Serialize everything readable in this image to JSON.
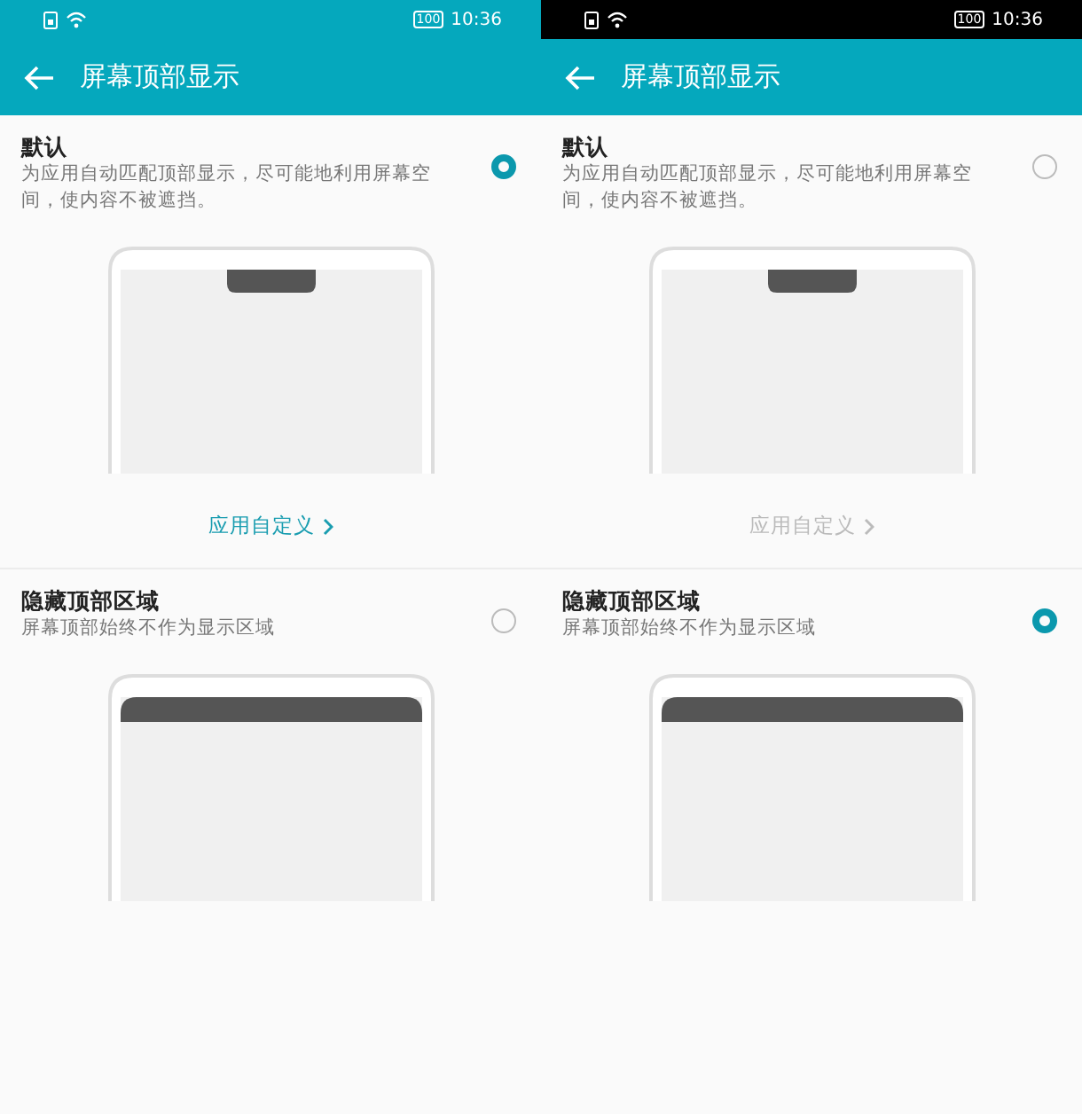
{
  "screens": [
    {
      "status_bar": {
        "kind": "teal",
        "battery": "100",
        "time": "10:36"
      },
      "title": "屏幕顶部显示",
      "options": [
        {
          "kind": "notch",
          "title": "默认",
          "description": "为应用自动匹配顶部显示，尽可能地利用屏幕空间，使内容不被遮挡。",
          "selected": true,
          "link": {
            "label": "应用自定义",
            "disabled": false
          }
        },
        {
          "kind": "hidden",
          "title": "隐藏顶部区域",
          "description": "屏幕顶部始终不作为显示区域",
          "selected": false
        }
      ]
    },
    {
      "status_bar": {
        "kind": "dark",
        "battery": "100",
        "time": "10:36"
      },
      "title": "屏幕顶部显示",
      "options": [
        {
          "kind": "notch",
          "title": "默认",
          "description": "为应用自动匹配顶部显示，尽可能地利用屏幕空间，使内容不被遮挡。",
          "selected": false,
          "link": {
            "label": "应用自定义",
            "disabled": true
          }
        },
        {
          "kind": "hidden",
          "title": "隐藏顶部区域",
          "description": "屏幕顶部始终不作为显示区域",
          "selected": true
        }
      ]
    }
  ]
}
